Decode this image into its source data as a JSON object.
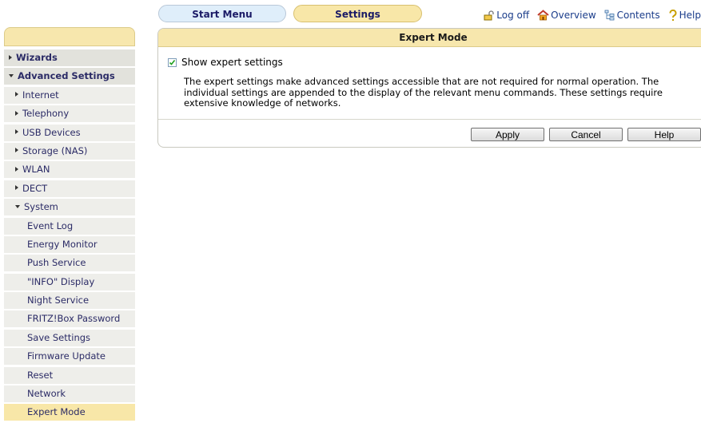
{
  "tabs": {
    "start_menu": "Start Menu",
    "settings": "Settings"
  },
  "toplinks": {
    "logoff": "Log off",
    "overview": "Overview",
    "contents": "Contents",
    "help": "Help"
  },
  "sidebar": {
    "items": [
      {
        "label": "Wizards",
        "level": 0,
        "arrow": "right"
      },
      {
        "label": "Advanced Settings",
        "level": 0,
        "arrow": "down"
      },
      {
        "label": "Internet",
        "level": 1,
        "arrow": "right"
      },
      {
        "label": "Telephony",
        "level": 1,
        "arrow": "right"
      },
      {
        "label": "USB Devices",
        "level": 1,
        "arrow": "right"
      },
      {
        "label": "Storage (NAS)",
        "level": 1,
        "arrow": "right"
      },
      {
        "label": "WLAN",
        "level": 1,
        "arrow": "right"
      },
      {
        "label": "DECT",
        "level": 1,
        "arrow": "right"
      },
      {
        "label": "System",
        "level": 1,
        "arrow": "down"
      },
      {
        "label": "Event Log",
        "level": 2
      },
      {
        "label": "Energy Monitor",
        "level": 2
      },
      {
        "label": "Push Service",
        "level": 2
      },
      {
        "label": "\"INFO\" Display",
        "level": 2
      },
      {
        "label": "Night Service",
        "level": 2
      },
      {
        "label": "FRITZ!Box Password",
        "level": 2
      },
      {
        "label": "Save Settings",
        "level": 2
      },
      {
        "label": "Firmware Update",
        "level": 2
      },
      {
        "label": "Reset",
        "level": 2
      },
      {
        "label": "Network",
        "level": 2
      },
      {
        "label": "Expert Mode",
        "level": 2,
        "active": true
      }
    ]
  },
  "panel": {
    "title": "Expert Mode",
    "checkbox_label": "Show expert settings",
    "checkbox_checked": true,
    "description": "The expert settings make advanced settings accessible that are not required for normal operation. The individual settings are appended to the display of the relevant menu commands. These settings require extensive knowledge of networks.",
    "buttons": {
      "apply": "Apply",
      "cancel": "Cancel",
      "help": "Help"
    }
  }
}
